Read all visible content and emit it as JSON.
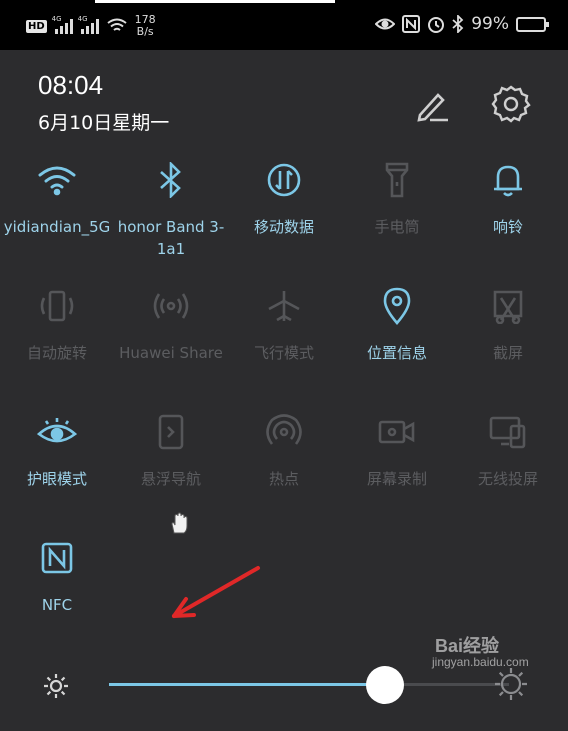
{
  "status_bar": {
    "hd_badge": "HD",
    "signal1_label": "4G",
    "signal2_label": "4G",
    "speed_value": "178",
    "speed_unit": "B/s",
    "battery": "99%",
    "icons": [
      "eye-icon",
      "nfc-icon",
      "alarm-icon",
      "bluetooth-icon",
      "battery-icon"
    ]
  },
  "header": {
    "time": "08:04",
    "date": "6月10日星期一"
  },
  "tiles": [
    {
      "icon": "wifi-icon",
      "label": "yidiandian_5G",
      "active": true
    },
    {
      "icon": "bluetooth-icon",
      "label": "honor Band 3-1a1",
      "active": true
    },
    {
      "icon": "mobile-data-icon",
      "label": "移动数据",
      "active": true
    },
    {
      "icon": "flashlight-icon",
      "label": "手电筒",
      "active": false
    },
    {
      "icon": "bell-icon",
      "label": "响铃",
      "active": true
    },
    {
      "icon": "auto-rotate-icon",
      "label": "自动旋转",
      "active": false
    },
    {
      "icon": "huawei-share-icon",
      "label": "Huawei Share",
      "active": false
    },
    {
      "icon": "airplane-icon",
      "label": "飞行模式",
      "active": false
    },
    {
      "icon": "location-icon",
      "label": "位置信息",
      "active": true
    },
    {
      "icon": "screenshot-icon",
      "label": "截屏",
      "active": false
    },
    {
      "icon": "eye-icon",
      "label": "护眼模式",
      "active": true
    },
    {
      "icon": "floating-nav-icon",
      "label": "悬浮导航",
      "active": false
    },
    {
      "icon": "hotspot-icon",
      "label": "热点",
      "active": false
    },
    {
      "icon": "screen-record-icon",
      "label": "屏幕录制",
      "active": false
    },
    {
      "icon": "wireless-projection-icon",
      "label": "无线投屏",
      "active": false
    },
    {
      "icon": "nfc-icon",
      "label": "NFC",
      "active": true
    }
  ],
  "brightness": {
    "level_percent": 69
  },
  "watermark": {
    "logo": "Bai经验",
    "url": "jingyan.baidu.com"
  },
  "colors": {
    "accent": "#7cc7e6",
    "panel": "#2c2c2e",
    "inactive": "#555659",
    "arrow": "#e02828"
  }
}
